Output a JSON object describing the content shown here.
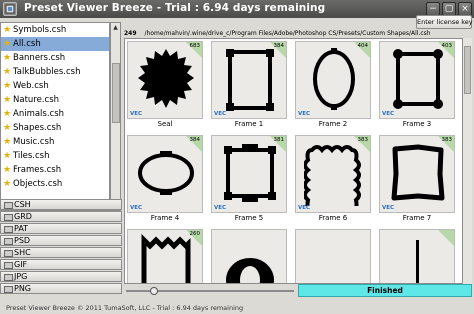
{
  "window": {
    "title": "Preset Viewer Breeze - Trial : 6.94 days remaining",
    "controls": [
      "−",
      "▢",
      "×"
    ]
  },
  "toolbar": {
    "enter_license_label": "Enter license key"
  },
  "sets": [
    {
      "name": "Symbols.csh",
      "selected": false
    },
    {
      "name": "All.csh",
      "selected": true
    },
    {
      "name": "Banners.csh",
      "selected": false
    },
    {
      "name": "TalkBubbles.csh",
      "selected": false
    },
    {
      "name": "Web.csh",
      "selected": false
    },
    {
      "name": "Nature.csh",
      "selected": false
    },
    {
      "name": "Animals.csh",
      "selected": false
    },
    {
      "name": "Shapes.csh",
      "selected": false
    },
    {
      "name": "Music.csh",
      "selected": false
    },
    {
      "name": "Tiles.csh",
      "selected": false
    },
    {
      "name": "Frames.csh",
      "selected": false
    },
    {
      "name": "Objects.csh",
      "selected": false
    }
  ],
  "preset_types": [
    "CSH",
    "GRD",
    "PAT",
    "PSD",
    "SHC",
    "GIF",
    "JPG",
    "PNG"
  ],
  "path": {
    "count": "249",
    "location": "/home/mahvin/.wine/drive_c/Program Files/Adobe/Photoshop CS/Presets/Custom Shapes/All.csh"
  },
  "shapes": [
    {
      "label": "Seal",
      "num": "683",
      "vec": "VEC",
      "icon": "seal-shape-icon"
    },
    {
      "label": "Frame 1",
      "num": "384",
      "vec": "VEC",
      "icon": "frame1-shape-icon"
    },
    {
      "label": "Frame 2",
      "num": "404",
      "vec": "VEC",
      "icon": "frame2-shape-icon"
    },
    {
      "label": "Frame 3",
      "num": "403",
      "vec": "VEC",
      "icon": "frame3-shape-icon"
    },
    {
      "label": "Frame 4",
      "num": "384",
      "vec": "VEC",
      "icon": "frame4-shape-icon"
    },
    {
      "label": "Frame 5",
      "num": "381",
      "vec": "VEC",
      "icon": "frame5-shape-icon"
    },
    {
      "label": "Frame 6",
      "num": "383",
      "vec": "VEC",
      "icon": "frame6-shape-icon"
    },
    {
      "label": "Frame 7",
      "num": "383",
      "vec": "VEC",
      "icon": "frame7-shape-icon"
    },
    {
      "label": "",
      "num": "260",
      "vec": "",
      "icon": "zigzag-frame-shape-icon"
    },
    {
      "label": "",
      "num": "",
      "vec": "",
      "icon": "ellipse-ring-shape-icon"
    },
    {
      "label": "",
      "num": "",
      "vec": "",
      "icon": "blank-shape-icon"
    },
    {
      "label": "",
      "num": "",
      "vec": "",
      "icon": "line-shape-icon"
    }
  ],
  "progress": {
    "label": "Finished",
    "value": 1.0
  },
  "slider": {
    "value": 0.15
  },
  "status": "Preset Viewer Breeze © 2011 TumaSoft, LLC - Trial : 6.94 days remaining",
  "colors": {
    "selection": "#86abd9",
    "progress": "#5fe6e6",
    "badge": "#b7d9a8",
    "vec": "#2a6ebb"
  }
}
